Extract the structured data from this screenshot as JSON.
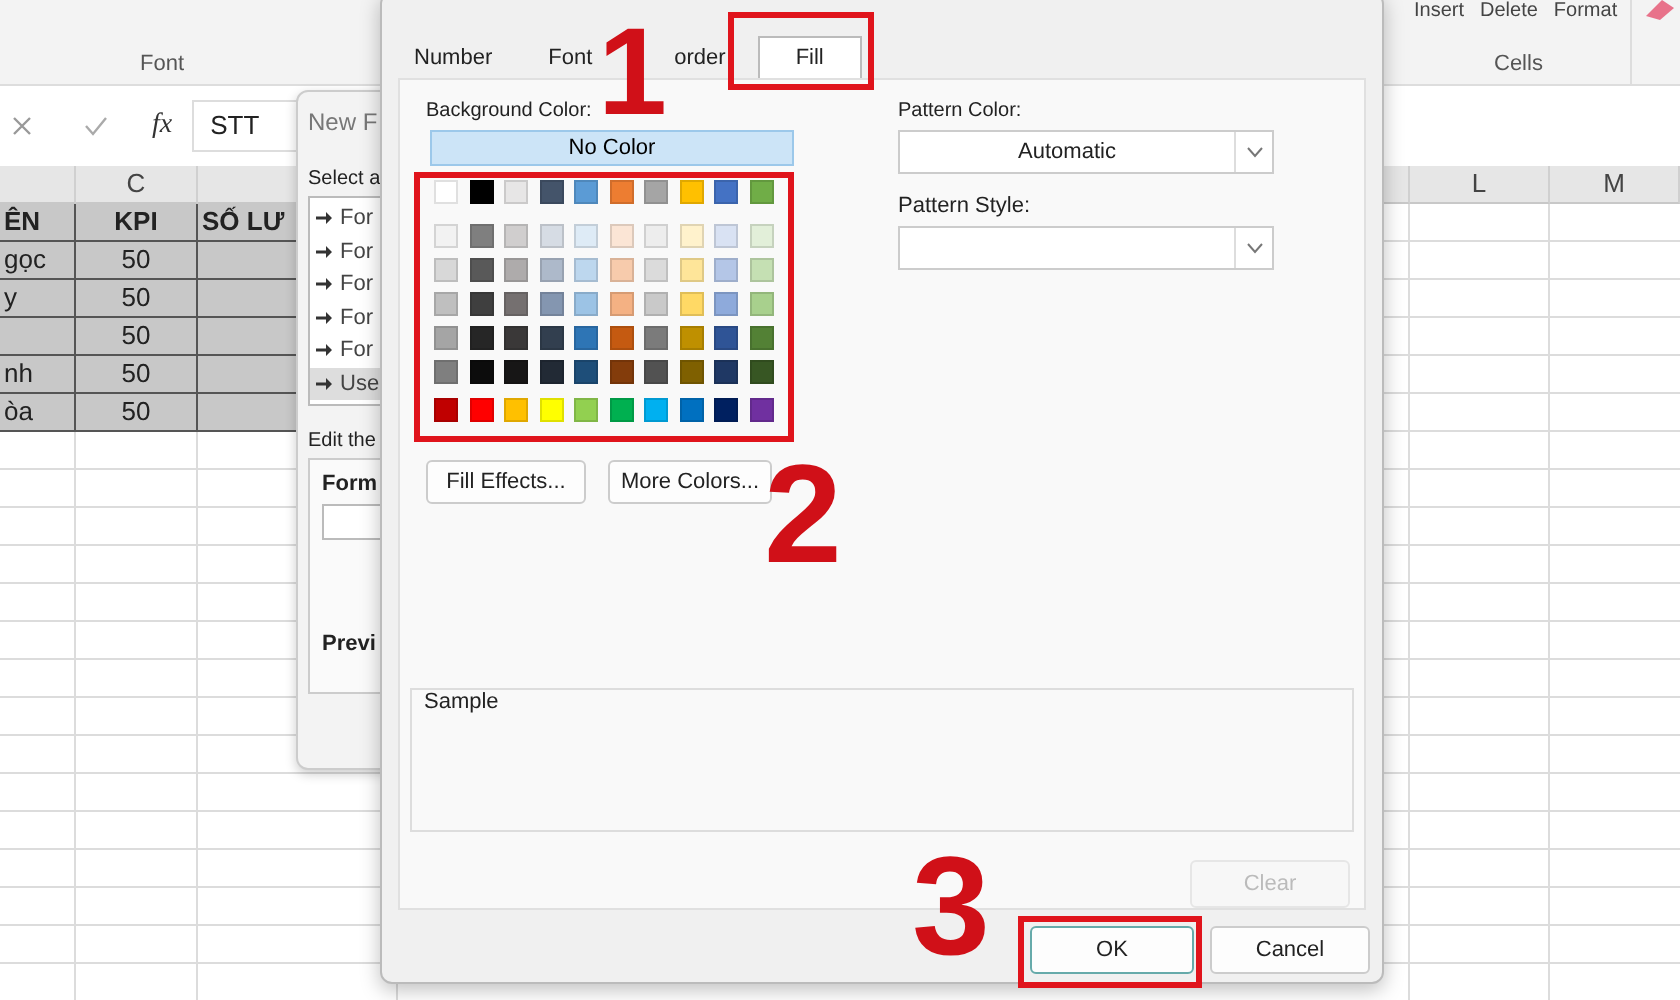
{
  "ribbon": {
    "font_group": "Font",
    "cells_buttons": [
      "Insert",
      "Delete",
      "Format"
    ],
    "cells_group": "Cells"
  },
  "formula_bar": {
    "fx": "fx",
    "value": "STT"
  },
  "sheet": {
    "column_headers": [
      "C",
      "L",
      "M"
    ],
    "header_row": [
      "ÊN",
      "KPI",
      "SỐ LƯ"
    ],
    "rows": [
      {
        "name": "gọc",
        "kpi": "50"
      },
      {
        "name": "y",
        "kpi": "50"
      },
      {
        "kpi": "50"
      },
      {
        "name": "nh",
        "kpi": "50"
      },
      {
        "name": "òa",
        "kpi": "50"
      }
    ]
  },
  "rule_dialog": {
    "title": "New F",
    "select_label": "Select a",
    "rule_types": [
      {
        "label": "For",
        "selected": false
      },
      {
        "label": "For",
        "selected": false
      },
      {
        "label": "For",
        "selected": false
      },
      {
        "label": "For",
        "selected": false
      },
      {
        "label": "For",
        "selected": false
      },
      {
        "label": "Use",
        "selected": true
      }
    ],
    "edit_label": "Edit the",
    "format_label": "Form",
    "preview_label": "Previ"
  },
  "format_dialog": {
    "tabs": [
      {
        "label": "Number",
        "selected": false
      },
      {
        "label": "Font",
        "selected": false
      },
      {
        "label": "order",
        "selected": false
      },
      {
        "label": "Fill",
        "selected": true
      }
    ],
    "background_color_label": "Background Color:",
    "no_color": "No Color",
    "palette_rows": [
      {
        "kind": "theme",
        "swatches": [
          {
            "color": "#ffffff"
          },
          {
            "color": "#000000"
          },
          {
            "color": "#e7e6e6"
          },
          {
            "color": "#44546a"
          },
          {
            "color": "#5b9bd5"
          },
          {
            "color": "#ed7d31"
          },
          {
            "color": "#a5a5a5"
          },
          {
            "color": "#ffc000"
          },
          {
            "color": "#4472c4"
          },
          {
            "color": "#70ad47"
          }
        ]
      },
      {
        "kind": "shade",
        "swatches": [
          {
            "color": "#f2f2f2"
          },
          {
            "color": "#7f7f7f"
          },
          {
            "color": "#d0cece"
          },
          {
            "color": "#d6dce4"
          },
          {
            "color": "#deebf6"
          },
          {
            "color": "#fbe5d5"
          },
          {
            "color": "#ededed"
          },
          {
            "color": "#fff2cc"
          },
          {
            "color": "#d9e2f3"
          },
          {
            "color": "#e2efd9"
          }
        ]
      },
      {
        "kind": "shade",
        "swatches": [
          {
            "color": "#d8d8d8"
          },
          {
            "color": "#595959"
          },
          {
            "color": "#aeabab"
          },
          {
            "color": "#adb9ca"
          },
          {
            "color": "#bdd7ee"
          },
          {
            "color": "#f7cbac"
          },
          {
            "color": "#dbdbdb"
          },
          {
            "color": "#fee599"
          },
          {
            "color": "#b4c6e7"
          },
          {
            "color": "#c5e0b3"
          }
        ]
      },
      {
        "kind": "shade",
        "swatches": [
          {
            "color": "#bfbfbf"
          },
          {
            "color": "#3f3f3f"
          },
          {
            "color": "#757070"
          },
          {
            "color": "#8496b0"
          },
          {
            "color": "#9cc3e5"
          },
          {
            "color": "#f4b183"
          },
          {
            "color": "#c9c9c9"
          },
          {
            "color": "#ffd965"
          },
          {
            "color": "#8eaadb"
          },
          {
            "color": "#a8d08d"
          }
        ]
      },
      {
        "kind": "shade",
        "swatches": [
          {
            "color": "#a5a5a5"
          },
          {
            "color": "#262626"
          },
          {
            "color": "#3a3838"
          },
          {
            "color": "#323f4f"
          },
          {
            "color": "#2e75b5"
          },
          {
            "color": "#c55a11"
          },
          {
            "color": "#7b7b7b"
          },
          {
            "color": "#bf9000"
          },
          {
            "color": "#2f5496"
          },
          {
            "color": "#538135"
          }
        ]
      },
      {
        "kind": "shade",
        "swatches": [
          {
            "color": "#7f7f7f"
          },
          {
            "color": "#0c0c0c"
          },
          {
            "color": "#171616"
          },
          {
            "color": "#222a35"
          },
          {
            "color": "#1e4e79"
          },
          {
            "color": "#833c0b"
          },
          {
            "color": "#525252"
          },
          {
            "color": "#7f6000"
          },
          {
            "color": "#1f3864"
          },
          {
            "color": "#375623"
          }
        ]
      },
      {
        "kind": "standard",
        "swatches": [
          {
            "color": "#c00000"
          },
          {
            "color": "#ff0000"
          },
          {
            "color": "#ffc000"
          },
          {
            "color": "#ffff00"
          },
          {
            "color": "#92d050"
          },
          {
            "color": "#00b050"
          },
          {
            "color": "#00b0f0"
          },
          {
            "color": "#0070c0"
          },
          {
            "color": "#002060"
          },
          {
            "color": "#7030a0"
          }
        ]
      }
    ],
    "buttons_left": [
      {
        "label": "Fill Effects..."
      },
      {
        "label": "More Colors..."
      }
    ],
    "pattern_color_label": "Pattern Color:",
    "pattern_color_value": "Automatic",
    "pattern_style_label": "Pattern Style:",
    "sample_label": "Sample",
    "clear": {
      "label": "Clear",
      "disabled": true
    },
    "ok": "OK",
    "cancel": "Cancel"
  },
  "annotations": [
    {
      "label": "1"
    },
    {
      "label": "2"
    },
    {
      "label": "3"
    }
  ]
}
